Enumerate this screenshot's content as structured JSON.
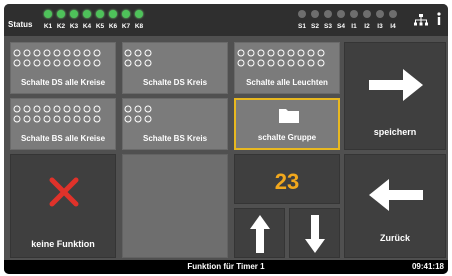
{
  "statusbar": {
    "label": "Status",
    "k_channels": [
      "K1",
      "K2",
      "K3",
      "K4",
      "K5",
      "K6",
      "K7",
      "K8"
    ],
    "s_channels": [
      "S1",
      "S2",
      "S3",
      "S4",
      "I1",
      "I2",
      "I3",
      "I4"
    ]
  },
  "tiles": {
    "schalte_ds_alle_kreise": "Schalte DS alle Kreise",
    "schalte_ds_kreis": "Schalte DS Kreis",
    "schalte_alle_leuchten": "Schalte alle Leuchten",
    "schalte_bs_alle_kreise": "Schalte BS alle Kreise",
    "schalte_bs_kreis": "Schalte BS Kreis",
    "schalte_gruppe": "schalte Gruppe",
    "speichern": "speichern",
    "keine_funktion": "keine Funktion",
    "zurueck": "Zurück"
  },
  "counter": {
    "value": "23"
  },
  "bottombar": {
    "title": "Funktion für Timer 1",
    "time": "09:41:18"
  },
  "colors": {
    "highlight": "#e8b820",
    "counter": "#f2a81d",
    "led_on": "#4ec25a",
    "led_off": "#6e6e6e",
    "cross": "#e0322a"
  }
}
